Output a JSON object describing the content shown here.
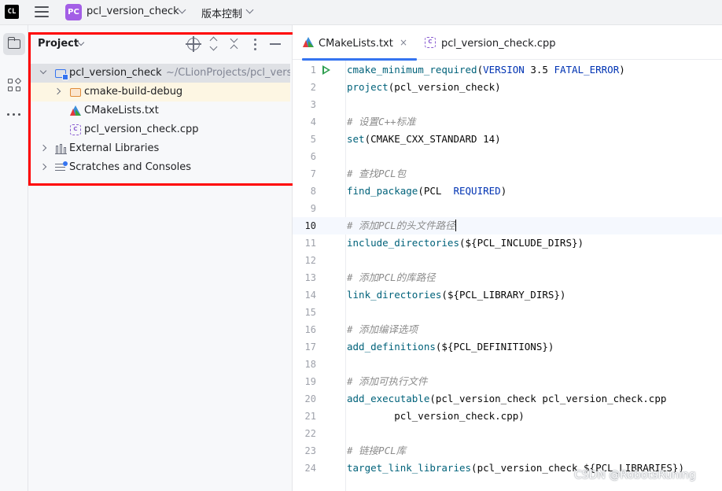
{
  "titlebar": {
    "app_logo": "CL",
    "project_badge": "PC",
    "project_name": "pcl_version_check",
    "vcs_label": "版本控制"
  },
  "project_panel": {
    "title": "Project",
    "tree": [
      {
        "label": "pcl_version_check",
        "path": "~/CLionProjects/pcl_versi",
        "icon": "module-folder-icon"
      },
      {
        "label": "cmake-build-debug",
        "icon": "excluded-folder-icon"
      },
      {
        "label": "CMakeLists.txt",
        "icon": "cmake-icon"
      },
      {
        "label": "pcl_version_check.cpp",
        "icon": "cpp-file-icon"
      },
      {
        "label": "External Libraries",
        "icon": "library-icon"
      },
      {
        "label": "Scratches and Consoles",
        "icon": "scratches-icon"
      }
    ]
  },
  "tabs": [
    {
      "label": "CMakeLists.txt",
      "close": "×",
      "active": true
    },
    {
      "label": "pcl_version_check.cpp",
      "active": false
    }
  ],
  "code": {
    "current_line": 10,
    "lines": [
      {
        "n": "1",
        "fn": "cmake_minimum_required",
        "rest": "(VERSION 3.5 FATAL_ERROR)"
      },
      {
        "n": "2",
        "fn": "project",
        "rest": "(pcl_version_check)"
      },
      {
        "n": "3"
      },
      {
        "n": "4",
        "comment": "# 设置C++标准"
      },
      {
        "n": "5",
        "fn": "set",
        "rest": "(CMAKE_CXX_STANDARD 14)"
      },
      {
        "n": "6"
      },
      {
        "n": "7",
        "comment": "# 查找PCL包"
      },
      {
        "n": "8",
        "fn": "find_package",
        "rest": "(PCL  REQUIRED)"
      },
      {
        "n": "9"
      },
      {
        "n": "10",
        "comment": "# 添加PCL的头文件路径"
      },
      {
        "n": "11",
        "fn": "include_directories",
        "rest": "(${PCL_INCLUDE_DIRS})"
      },
      {
        "n": "12"
      },
      {
        "n": "13",
        "comment": "# 添加PCL的库路径"
      },
      {
        "n": "14",
        "fn": "link_directories",
        "rest": "(${PCL_LIBRARY_DIRS})"
      },
      {
        "n": "15"
      },
      {
        "n": "16",
        "comment": "# 添加编译选项"
      },
      {
        "n": "17",
        "fn": "add_definitions",
        "rest": "(${PCL_DEFINITIONS})"
      },
      {
        "n": "18"
      },
      {
        "n": "19",
        "comment": "# 添加可执行文件"
      },
      {
        "n": "20",
        "fn": "add_executable",
        "rest": "(pcl_version_check pcl_version_check.cpp"
      },
      {
        "n": "21",
        "rest": "        pcl_version_check.cpp)"
      },
      {
        "n": "22"
      },
      {
        "n": "23",
        "comment": "# 链接PCL库"
      },
      {
        "n": "24",
        "fn": "target_link_libraries",
        "rest": "(pcl_version_check ${PCL_LIBRARIES})"
      }
    ]
  },
  "watermark": "CSDN @RobotsRuning",
  "colors": {
    "accent": "#3574f0",
    "highlight_border": "#ff0000",
    "function": "#00627a",
    "keyword": "#0033b3",
    "comment": "#8c8c8c",
    "project_badge": "#a35ee6"
  }
}
